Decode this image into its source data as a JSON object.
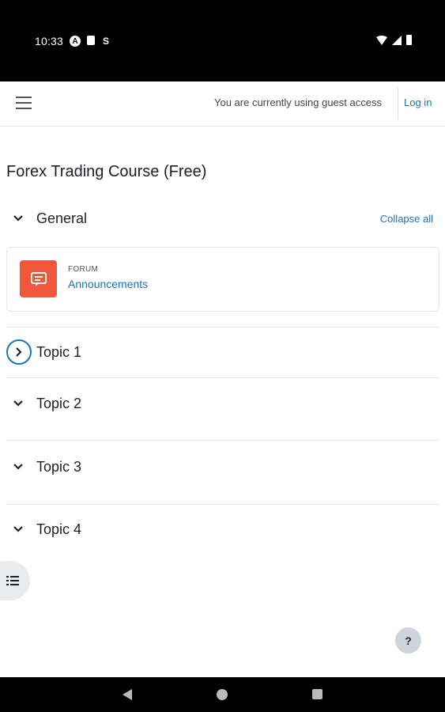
{
  "status_bar": {
    "time": "10:33",
    "icons": [
      "a-icon",
      "sim-card-icon",
      "s-icon",
      "wifi-icon",
      "signal-icon",
      "battery-icon"
    ]
  },
  "navbar": {
    "menu_icon": "hamburger-icon",
    "guest_text": "You are currently using guest access",
    "login_label": "Log in"
  },
  "course": {
    "title": "Forex Trading Course (Free)",
    "collapse_all": "Collapse all",
    "sections": [
      {
        "title": "General",
        "expanded": true,
        "activities": [
          {
            "type": "FORUM",
            "name": "Announcements",
            "icon": "forum-icon",
            "icon_color": "#f0573b"
          }
        ]
      },
      {
        "title": "Topic 1",
        "expanded": false
      },
      {
        "title": "Topic 2",
        "expanded": true
      },
      {
        "title": "Topic 3",
        "expanded": true
      },
      {
        "title": "Topic 4",
        "expanded": true
      }
    ]
  },
  "floating": {
    "help_label": "?",
    "index_icon": "list-icon"
  },
  "colors": {
    "link": "#1a73b8",
    "forum": "#f0573b"
  }
}
